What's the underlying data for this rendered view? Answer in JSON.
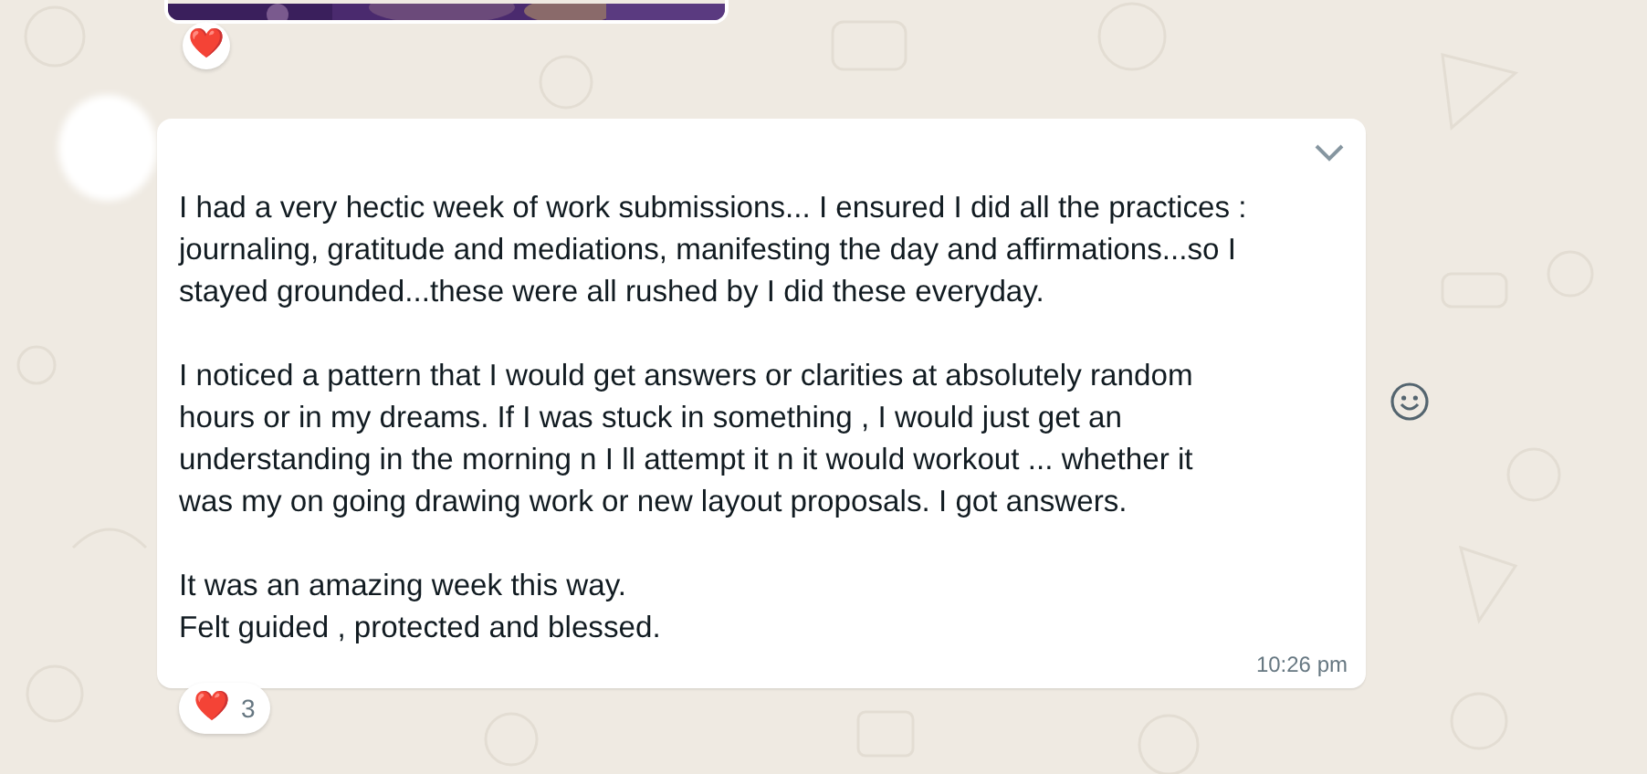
{
  "previous_message": {
    "kind": "picture",
    "reaction": {
      "emoji": "❤️"
    }
  },
  "message": {
    "paragraphs": [
      "I had a very hectic week of work submissions... I ensured I did all the practices :\njournaling, gratitude and mediations, manifesting the day and affirmations...so I\nstayed grounded...these were all rushed by I did these everyday.",
      "I noticed a pattern that I would get answers or clarities at absolutely random\nhours or in my dreams. If I was stuck in something , I would just get an\nunderstanding in the morning n I ll attempt it n it would workout ... whether it\nwas my on going drawing work or new layout proposals. I got answers.",
      "It was an amazing week this way.\nFelt guided , protected and blessed."
    ],
    "time": "10:26 pm",
    "reaction": {
      "emoji": "❤️",
      "count": "3"
    }
  }
}
